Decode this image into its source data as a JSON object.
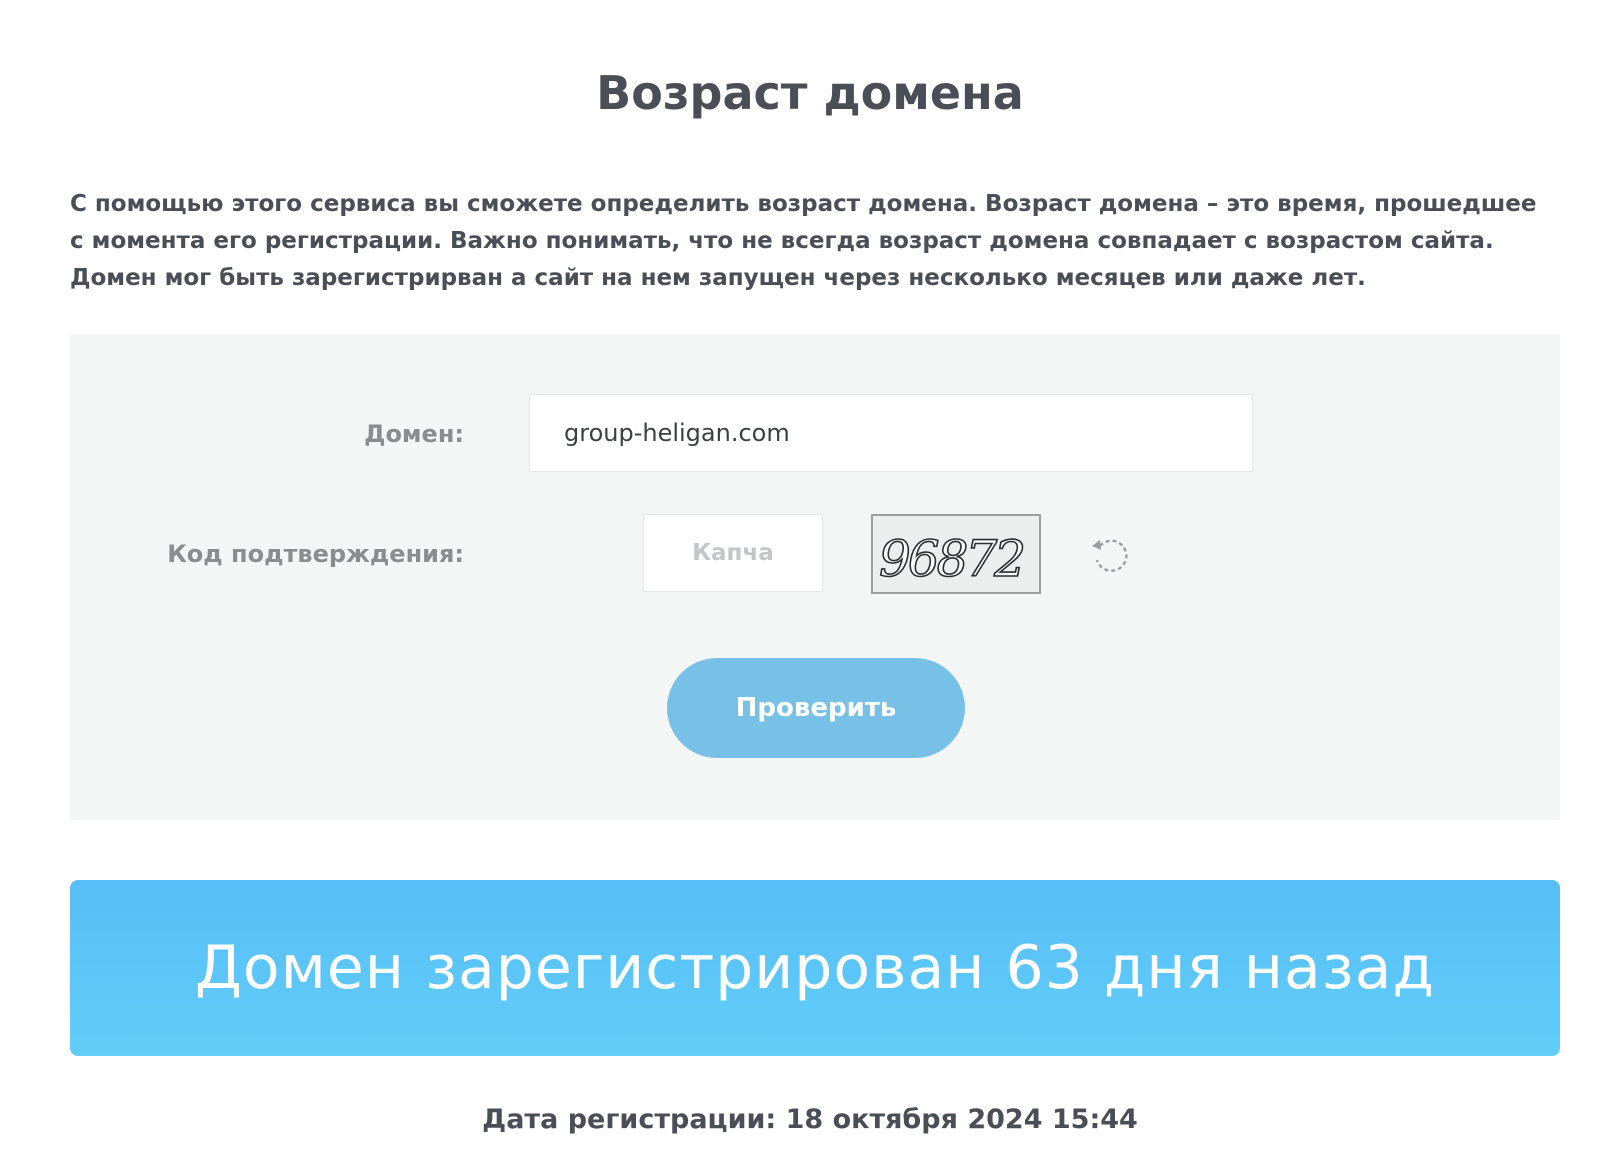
{
  "page": {
    "title": "Возраст домена",
    "intro": "С помощью этого сервиса вы сможете определить возраст домена. Возраст домена – это время, прошедшее с момента его регистрации. Важно понимать, что не всегда возраст домена совпадает с возрастом сайта. Домен мог быть зарегистрирван а сайт на нем запущен через несколько месяцев или даже лет."
  },
  "form": {
    "domain_label": "Домен:",
    "domain_value": "group-heligan.com",
    "captcha_label": "Код подтверждения:",
    "captcha_placeholder": "Капча",
    "captcha_value": "",
    "captcha_code": "96872",
    "refresh_icon": "refresh-icon",
    "submit_label": "Проверить"
  },
  "result": {
    "message": "Домен зарегистрирован 63 дня назад",
    "registration_date": "Дата регистрации: 18 октября 2024 15:44"
  },
  "colors": {
    "button_bg": "#77c1e6",
    "banner_top": "#57bef7",
    "banner_bottom": "#62cdf8",
    "panel_bg": "#f4f5f5",
    "text": "#4a4e57",
    "label": "#8a8c8f"
  }
}
